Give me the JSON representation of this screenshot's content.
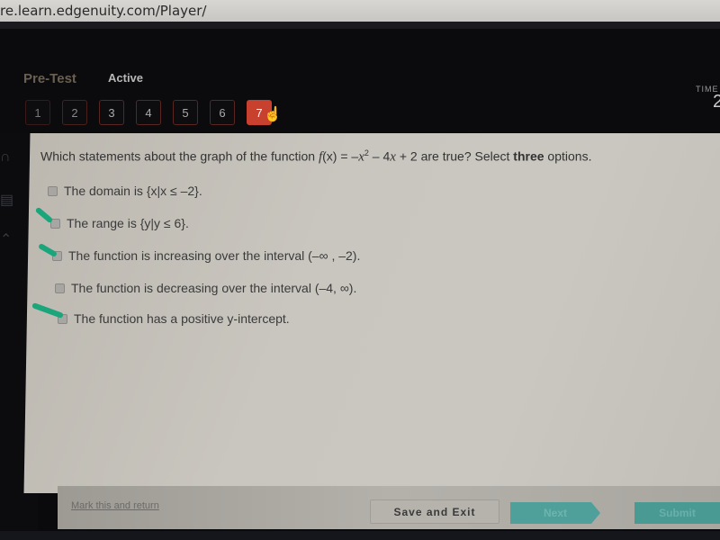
{
  "browser": {
    "url": "re.learn.edgenuity.com/Player/"
  },
  "header": {
    "course_label": "Pre-Test",
    "status_label": "Active",
    "timer_label": "TIME",
    "timer_value": "2"
  },
  "question_nav": {
    "items": [
      "1",
      "2",
      "3",
      "4",
      "5",
      "6",
      "7"
    ],
    "active": "7"
  },
  "question": {
    "prefix": "Which statements about the graph of the function ",
    "func_name": "f",
    "func_arg": "(x) = –",
    "func_var": "x",
    "exponent": "2",
    "func_rest": " – 4",
    "func_var2": "x",
    "func_tail": " + 2 are true? Select ",
    "emphasis": "three",
    "suffix": " options."
  },
  "options": [
    {
      "text": "The domain is {x|x ≤ –2}.",
      "checked": false,
      "marked": false
    },
    {
      "text": "The range is {y|y ≤ 6}.",
      "checked": false,
      "marked": true
    },
    {
      "text": "The function is increasing over the interval (–∞ , –2).",
      "checked": false,
      "marked": true
    },
    {
      "text": "The function is decreasing over the interval (–4, ∞).",
      "checked": false,
      "marked": false
    },
    {
      "text": "The function has a positive y-intercept.",
      "checked": false,
      "marked": true
    }
  ],
  "footer": {
    "mark_link": "Mark this and return",
    "save_exit": "Save and Exit",
    "next": "Next",
    "submit": "Submit"
  },
  "colors": {
    "active_question": "#c8412e",
    "annotation_mark": "#1aa67a",
    "nav_button": "#4fa09a"
  }
}
